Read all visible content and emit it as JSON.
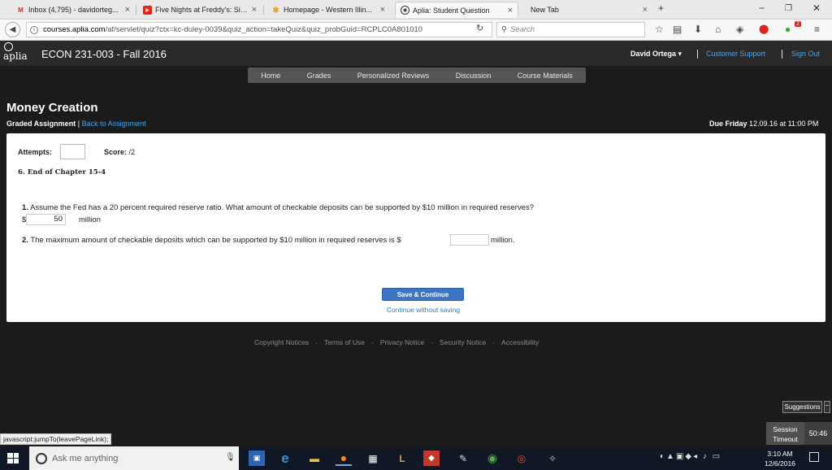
{
  "browser": {
    "tabs": [
      {
        "label": "Inbox (4,795) - davidorteg...",
        "icon": "gmail-icon",
        "icon_glyph": "M",
        "icon_color": "#d93025"
      },
      {
        "label": "Five Nights at Freddy's: Sis...",
        "icon": "youtube-icon",
        "icon_glyph": "▶",
        "icon_color": "#e62117"
      },
      {
        "label": "Homepage - Western Illin...",
        "icon": "western-illinois-icon",
        "icon_glyph": "✱",
        "icon_color": "#e3a020"
      },
      {
        "label": "Aplia: Student Question",
        "icon": "aplia-icon",
        "icon_glyph": "◉",
        "icon_color": "#333333"
      },
      {
        "label": "New Tab",
        "icon": "",
        "icon_glyph": "",
        "icon_color": "#333333"
      }
    ],
    "url_host": "courses.aplia.com",
    "url_path": "/af/servlet/quiz?ctx=kc-duley-0039&quiz_action=takeQuiz&quiz_probGuid=RCPLC0A801010",
    "search_placeholder": "Search",
    "badge_count": "2"
  },
  "header": {
    "logo_text": "aplia",
    "course_title": "ECON 231-003 - Fall 2016",
    "user_name": "David Ortega ▾",
    "customer_support": "Customer Support",
    "sign_out": "Sign Out"
  },
  "menu": [
    "Home",
    "Grades",
    "Personalized Reviews",
    "Discussion",
    "Course Materials"
  ],
  "assignment": {
    "title": "Money Creation",
    "kind": "Graded Assignment",
    "separator": "|",
    "back_link": "Back to Assignment",
    "due_label": "Due Friday",
    "due_date": "12.09.16 at 11:00 PM"
  },
  "quiz": {
    "attempts_label": "Attempts:",
    "attempts_value": "",
    "score_label": "Score:",
    "score_value": "/2",
    "chapter": "6. End of Chapter 15-4",
    "q1_number": "1.",
    "q1_text": "Assume the Fed has a 20 percent required reserve ratio. What amount of checkable deposits can be supported by $10 million in required reserves?",
    "q1_currency": "$",
    "q1_answer": "50",
    "q1_unit": "million",
    "q2_number": "2.",
    "q2_text": "The maximum amount of checkable deposits which can be supported by $10 million in required reserves is $",
    "q2_answer": "",
    "q2_unit": "million.",
    "save_button": "Save & Continue",
    "continue_link": "Continue without saving"
  },
  "footer": [
    "Copyright Notices",
    "Terms of Use",
    "Privacy Notice",
    "Security Notice",
    "Accessibility"
  ],
  "footer_separator": "·",
  "widgets": {
    "suggestions": "Suggestions",
    "session_label": "Session Timeout",
    "session_time": "50:46",
    "status_url": "javascript:jumpTo(leavePageLink);"
  },
  "taskbar": {
    "search_placeholder": "Ask me anything",
    "time": "3:10 AM",
    "date": "12/6/2016"
  }
}
